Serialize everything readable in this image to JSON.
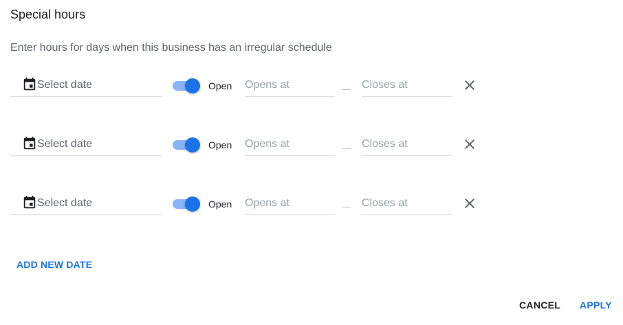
{
  "dialog": {
    "title": "Special hours",
    "subtitle": "Enter hours for days when this business has an irregular schedule"
  },
  "rows": [
    {
      "date_placeholder": "Select date",
      "open_label": "Open",
      "is_open": true,
      "opens_placeholder": "Opens at",
      "closes_placeholder": "Closes at",
      "remove_icon": "close-icon",
      "date_icon": "calendar-icon"
    },
    {
      "date_placeholder": "Select date",
      "open_label": "Open",
      "is_open": true,
      "opens_placeholder": "Opens at",
      "closes_placeholder": "Closes at",
      "remove_icon": "close-icon",
      "date_icon": "calendar-icon"
    },
    {
      "date_placeholder": "Select date",
      "open_label": "Open",
      "is_open": true,
      "opens_placeholder": "Opens at",
      "closes_placeholder": "Closes at",
      "remove_icon": "close-icon",
      "date_icon": "calendar-icon"
    }
  ],
  "actions": {
    "add_new_date": "ADD NEW DATE",
    "cancel": "CANCEL",
    "apply": "APPLY"
  },
  "colors": {
    "accent": "#1a73e8",
    "toggle_track": "#8ab4f8",
    "text_primary": "#202124",
    "text_secondary": "#5f6368",
    "placeholder": "#9aa0a6",
    "divider": "#dadce0"
  }
}
